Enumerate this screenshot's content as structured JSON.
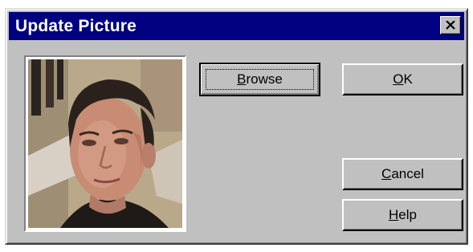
{
  "window": {
    "title": "Update Picture",
    "close_icon": "close-x-icon"
  },
  "picture": {
    "description_icon": "portrait-photo"
  },
  "buttons": {
    "browse": {
      "mnemonic": "B",
      "rest": "rowse"
    },
    "ok": {
      "mnemonic": "O",
      "rest": "K"
    },
    "cancel": {
      "mnemonic": "C",
      "rest": "ancel"
    },
    "help": {
      "mnemonic": "H",
      "rest": "elp"
    }
  },
  "colors": {
    "title_bar": "#000080",
    "dialog_face": "#c0c0c0"
  }
}
